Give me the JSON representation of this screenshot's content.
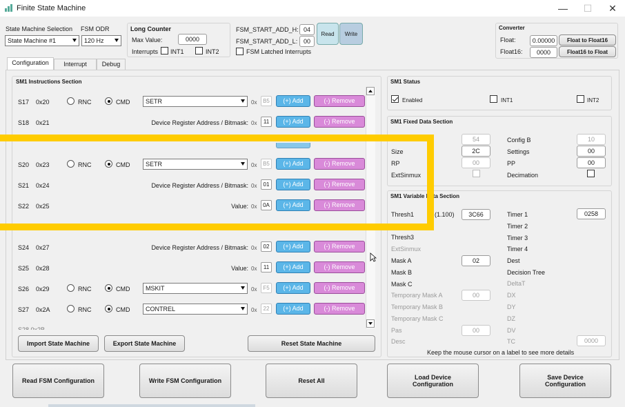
{
  "window": {
    "title": "Finite State Machine",
    "min": "—",
    "max": "☐",
    "close": "✕"
  },
  "top": {
    "sm_selection_label": "State Machine Selection",
    "sm_selection_value": "State Machine #1",
    "odr_label": "FSM ODR",
    "odr_value": "120 Hz",
    "long_counter_title": "Long Counter",
    "max_value_label": "Max Value:",
    "max_value": "0000",
    "interrupts_label": "Interrupts",
    "int1": "INT1",
    "int2": "INT2",
    "start_h_label": "FSM_START_ADD_H:",
    "start_h": "04",
    "start_l_label": "FSM_START_ADD_L:",
    "start_l": "00",
    "latched_label": "FSM Latched Interrupts",
    "read_label": "Read",
    "write_label": "Write",
    "converter_title": "Converter",
    "float_label": "Float:",
    "float_value": "0.00000",
    "float_btn": "Float to Float16",
    "float16_label": "Float16:",
    "float16_value": "0000",
    "float16_btn": "Float16 to Float"
  },
  "tabs": [
    "Configuration",
    "Interrupt",
    "Debug"
  ],
  "instructions": {
    "title": "SM1 Instructions Section",
    "rnc": "RNC",
    "cmd": "CMD",
    "ox": "0x",
    "add": "(+) Add",
    "remove": "(-) Remove",
    "rows": [
      {
        "s": "S17",
        "addr": "0x20",
        "type": "cmd",
        "value": "SETR",
        "hex": "B5",
        "hexdis": true
      },
      {
        "s": "S18",
        "addr": "0x21",
        "type": "text",
        "value": "Device Register Address / Bitmask:",
        "hex": "11"
      },
      {
        "s": "S20",
        "addr": "0x23",
        "type": "cmd",
        "value": "SETR",
        "hex": "B5",
        "hexdis": true
      },
      {
        "s": "S21",
        "addr": "0x24",
        "type": "text",
        "value": "Device Register Address / Bitmask:",
        "hex": "01"
      },
      {
        "s": "S22",
        "addr": "0x25",
        "type": "text",
        "value": "Value:",
        "hex": "0A"
      },
      {
        "s": "S24",
        "addr": "0x27",
        "type": "text",
        "value": "Device Register Address / Bitmask:",
        "hex": "02"
      },
      {
        "s": "S25",
        "addr": "0x28",
        "type": "text",
        "value": "Value:",
        "hex": "11"
      },
      {
        "s": "S26",
        "addr": "0x29",
        "type": "cmd",
        "value": "MSKIT",
        "hex": "F5",
        "hexdis": true
      },
      {
        "s": "S27",
        "addr": "0x2A",
        "type": "cmd",
        "value": "CONTREL",
        "hex": "22",
        "hexdis": true
      }
    ],
    "import_btn": "Import State Machine",
    "export_btn": "Export State Machine",
    "reset_btn": "Reset State Machine"
  },
  "status": {
    "title": "SM1 Status",
    "enabled": "Enabled",
    "int1": "INT1",
    "int2": "INT2"
  },
  "fixed": {
    "title": "SM1 Fixed Data Section",
    "left": [
      {
        "label": "",
        "value": "54"
      },
      {
        "label": "Size",
        "value": "2C"
      },
      {
        "label": "RP",
        "value": "00"
      },
      {
        "label": "ExtSinmux",
        "value": ""
      }
    ],
    "right": [
      {
        "label": "Config B",
        "value": "10"
      },
      {
        "label": "Settings",
        "value": "00"
      },
      {
        "label": "PP",
        "value": "00"
      },
      {
        "label": "Decimation",
        "value": ""
      }
    ]
  },
  "variable": {
    "title": "SM1 Variable Data Section",
    "thresh1_label": "Thresh1",
    "thresh1_range": "(1.100)",
    "thresh1_value": "3C66",
    "thresh3_label": "Thresh3",
    "extsinmux": "ExtSinmux",
    "mask_a_label": "Mask A",
    "mask_a_value": "02",
    "mask_b_label": "Mask B",
    "mask_c_label": "Mask C",
    "tmask_a_label": "Temporary Mask A",
    "tmask_a_value": "00",
    "tmask_b_label": "Temporary Mask B",
    "tmask_c_label": "Temporary Mask C",
    "pas_label": "Pas",
    "pas_value": "00",
    "desc_label": "Desc",
    "timer1_label": "Timer 1",
    "timer1_value": "0258",
    "timer2_label": "Timer 2",
    "timer3_label": "Timer 3",
    "timer4_label": "Timer 4",
    "dest_label": "Dest",
    "decision_label": "Decision Tree",
    "deltat_label": "DeltaT",
    "dx": "DX",
    "dy": "DY",
    "dz": "DZ",
    "dv": "DV",
    "tc": "TC",
    "tc_value": "0000",
    "hint": "Keep the mouse cursor on a label to see more details"
  },
  "bottom": {
    "read_cfg": "Read FSM Configuration",
    "write_cfg": "Write FSM Configuration",
    "reset_all": "Reset All",
    "load_dev": "Load Device Configuration",
    "save_dev": "Save Device Configuration"
  },
  "colors": {
    "overlay": "#ffcc00",
    "add": "#5bb6e8",
    "remove": "#d98ad9"
  }
}
